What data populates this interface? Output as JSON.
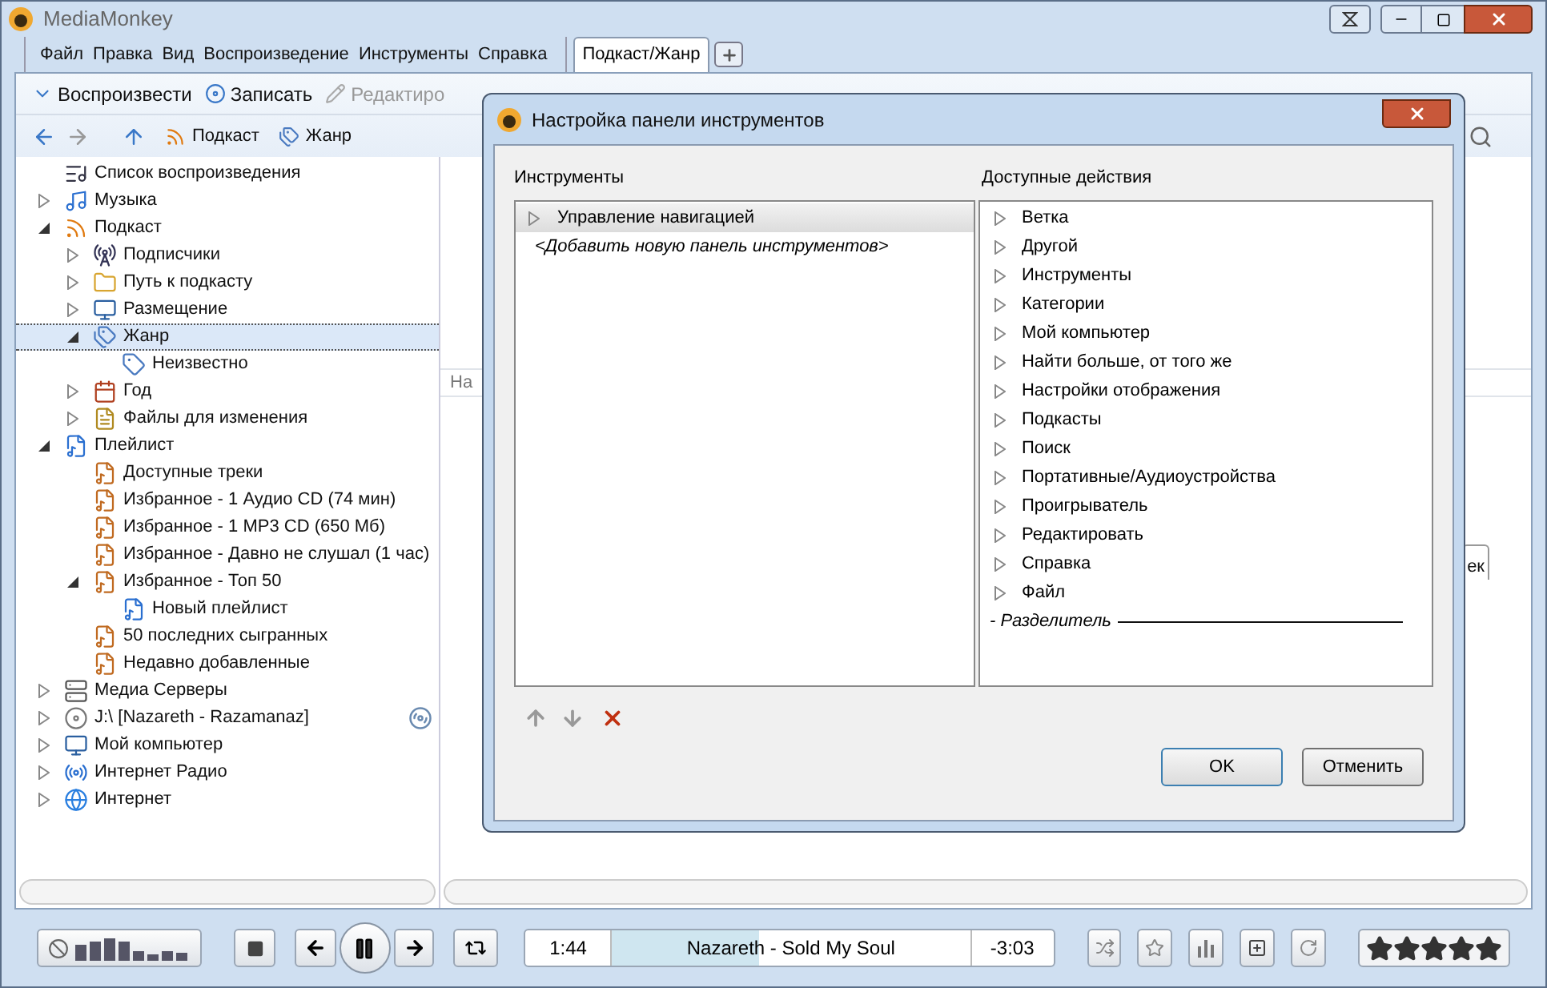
{
  "window": {
    "title": "MediaMonkey"
  },
  "menu": [
    "Файл",
    "Правка",
    "Вид",
    "Воспроизведение",
    "Инструменты",
    "Справка"
  ],
  "tabs": [
    {
      "label": "Подкаст/Жанр",
      "selected": true
    }
  ],
  "toolbar_1": [
    {
      "label": "Воспроизвести",
      "disabled": false
    },
    {
      "label": "Записать",
      "disabled": false
    },
    {
      "label": "Редактиро",
      "disabled": true
    }
  ],
  "toolbar_2": [
    {
      "label": "Подкаст"
    },
    {
      "label": "Жанр"
    }
  ],
  "tree": [
    {
      "label": "Список воспроизведения",
      "selected": false
    },
    {
      "label": "Музыка",
      "expanded": false,
      "selected": false
    },
    {
      "label": "Подкаст",
      "expanded": true,
      "selected": false,
      "children": [
        {
          "label": "Подписчики",
          "expanded": false,
          "selected": false
        },
        {
          "label": "Путь к подкасту",
          "expanded": false,
          "selected": false
        },
        {
          "label": "Размещение",
          "expanded": false,
          "selected": false
        },
        {
          "label": "Жанр",
          "expanded": true,
          "selected": true,
          "children": [
            {
              "label": "Неизвестно",
              "selected": false
            }
          ]
        },
        {
          "label": "Год",
          "expanded": false,
          "selected": false
        },
        {
          "label": "Файлы для изменения",
          "expanded": false,
          "selected": false
        }
      ]
    },
    {
      "label": "Плейлист",
      "expanded": true,
      "selected": false,
      "children": [
        {
          "label": "Доступные треки",
          "selected": false
        },
        {
          "label": "Избранное - 1 Аудио CD (74 мин)",
          "selected": false
        },
        {
          "label": "Избранное - 1 MP3 CD (650 Мб)",
          "selected": false
        },
        {
          "label": "Избранное - Давно не слушал (1 час)",
          "selected": false
        },
        {
          "label": "Избранное - Топ 50",
          "expanded": true,
          "selected": false,
          "children": [
            {
              "label": "Новый плейлист",
              "selected": false
            }
          ]
        },
        {
          "label": "50 последних сыгранных",
          "selected": false
        },
        {
          "label": "Недавно добавленные",
          "selected": false
        }
      ]
    },
    {
      "label": "Медиа Серверы",
      "expanded": false,
      "selected": false
    },
    {
      "label": "J:\\ [Nazareth - Razamanaz]",
      "expanded": false,
      "selected": false
    },
    {
      "label": "Мой компьютер",
      "expanded": false,
      "selected": false
    },
    {
      "label": "Интернет Радио",
      "expanded": false,
      "selected": false
    },
    {
      "label": "Интернет",
      "expanded": false,
      "selected": false
    }
  ],
  "content": {
    "column_1": "На",
    "tab": "ек"
  },
  "player": {
    "elapsed": "1:44",
    "title": "Nazareth - Sold My Soul",
    "remaining": "-3:03",
    "level": 0.41,
    "stars": 5
  },
  "dialog": {
    "title": "Настройка панели инструментов",
    "left_label": "Инструменты",
    "right_label": "Доступные действия",
    "toolbars": [
      {
        "label": "Управление навигацией",
        "kind": "item",
        "selected": true
      },
      {
        "label": "<Добавить новую панель инструментов>",
        "kind": "add",
        "selected": false
      }
    ],
    "actions": [
      {
        "label": "Ветка",
        "kind": "group"
      },
      {
        "label": "Другой",
        "kind": "group"
      },
      {
        "label": "Инструменты",
        "kind": "group"
      },
      {
        "label": "Категории",
        "kind": "group"
      },
      {
        "label": "Мой компьютер",
        "kind": "group"
      },
      {
        "label": "Найти больше, от того же",
        "kind": "group"
      },
      {
        "label": "Настройки отображения",
        "kind": "group"
      },
      {
        "label": "Подкасты",
        "kind": "group"
      },
      {
        "label": "Поиск",
        "kind": "group"
      },
      {
        "label": "Портативные/Аудиоустройства",
        "kind": "group"
      },
      {
        "label": "Проигрыватель",
        "kind": "group"
      },
      {
        "label": "Редактировать",
        "kind": "group"
      },
      {
        "label": "Справка",
        "kind": "group"
      },
      {
        "label": "Файл",
        "kind": "group"
      },
      {
        "label": "- Разделитель",
        "kind": "separator"
      }
    ],
    "buttons": [
      "OK",
      "Отменить"
    ]
  }
}
